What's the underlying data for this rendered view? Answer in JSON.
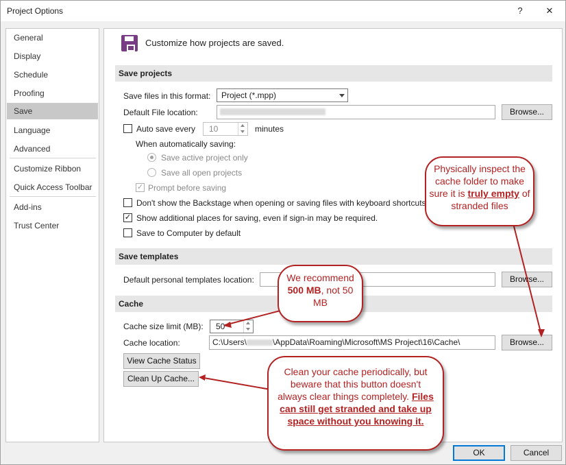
{
  "window": {
    "title": "Project Options",
    "help": "?",
    "close": "✕"
  },
  "nav": {
    "items": [
      "General",
      "Display",
      "Schedule",
      "Proofing",
      "Save",
      "Language",
      "Advanced",
      "Customize Ribbon",
      "Quick Access Toolbar",
      "Add-ins",
      "Trust Center"
    ],
    "selected": "Save"
  },
  "header": {
    "text": "Customize how projects are saved."
  },
  "save_projects": {
    "title": "Save projects",
    "format_label": "Save files in this format:",
    "format_value": "Project (*.mpp)",
    "location_label": "Default File location:",
    "browse": "Browse...",
    "autosave_label": "Auto save every",
    "autosave_value": "10",
    "minutes": "minutes",
    "when_label": "When automatically saving:",
    "opt_active": "Save active project only",
    "opt_all": "Save all open projects",
    "prompt": "Prompt before saving",
    "backstage": "Don't show the Backstage when opening or saving files with keyboard shortcuts",
    "additional": "Show additional places for saving, even if sign-in may be required.",
    "to_computer": "Save to Computer by default"
  },
  "templates": {
    "title": "Save templates",
    "label": "Default personal templates location:",
    "browse": "Browse..."
  },
  "cache": {
    "title": "Cache",
    "size_label": "Cache size limit (MB):",
    "size_value": "50",
    "location_label": "Cache location:",
    "location_prefix": "C:\\Users\\",
    "location_suffix": "\\AppData\\Roaming\\Microsoft\\MS Project\\16\\Cache\\",
    "browse": "Browse...",
    "view": "View Cache Status",
    "cleanup": "Clean Up Cache..."
  },
  "footer": {
    "ok": "OK",
    "cancel": "Cancel"
  },
  "callouts": {
    "inspect_a": "Physically inspect the cache folder to make sure it is",
    "inspect_b": "truly empty",
    "inspect_c": "of stranded files",
    "recommend_a": "We recommend",
    "recommend_b": "500 MB",
    "recommend_c": ", not 50 MB",
    "clean_a": "Clean your cache periodically, but beware that this button doesn't always clear things completely.",
    "clean_b": "Files can still get stranded and take up space without you knowing it."
  },
  "colors": {
    "callout": "#b22222",
    "selected_nav": "#c8c8c8",
    "section_bg": "#e6e6e6",
    "accent": "#0078d7"
  }
}
